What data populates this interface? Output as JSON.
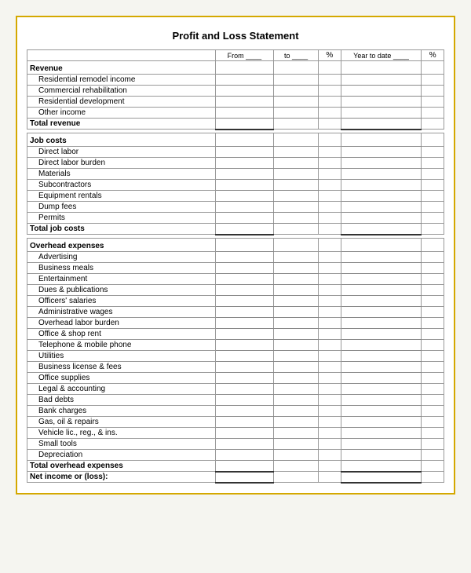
{
  "title": "Profit and Loss Statement",
  "header": {
    "col1": "",
    "col_from": "From ____",
    "col_to": "to ____",
    "col_pct1": "%",
    "col_ytd": "Year to date ____",
    "col_pct2": "%"
  },
  "sections": [
    {
      "type": "section-header",
      "label": "Revenue"
    },
    {
      "type": "indent",
      "label": "Residential remodel income"
    },
    {
      "type": "indent",
      "label": "Commercial rehabilitation"
    },
    {
      "type": "indent",
      "label": "Residential development"
    },
    {
      "type": "indent",
      "label": "Other income"
    },
    {
      "type": "total",
      "label": "Total revenue"
    },
    {
      "type": "blank"
    },
    {
      "type": "section-header",
      "label": "Job costs"
    },
    {
      "type": "indent",
      "label": "Direct labor"
    },
    {
      "type": "indent",
      "label": "Direct labor burden"
    },
    {
      "type": "indent",
      "label": "Materials"
    },
    {
      "type": "indent",
      "label": "Subcontractors"
    },
    {
      "type": "indent",
      "label": "Equipment rentals"
    },
    {
      "type": "indent",
      "label": "Dump fees"
    },
    {
      "type": "indent",
      "label": "Permits"
    },
    {
      "type": "total",
      "label": "Total job costs"
    },
    {
      "type": "blank"
    },
    {
      "type": "section-header",
      "label": "Overhead expenses"
    },
    {
      "type": "indent",
      "label": "Advertising"
    },
    {
      "type": "indent",
      "label": "Business meals"
    },
    {
      "type": "indent",
      "label": "Entertainment"
    },
    {
      "type": "indent",
      "label": "Dues & publications"
    },
    {
      "type": "indent",
      "label": "Officers' salaries"
    },
    {
      "type": "indent",
      "label": "Administrative wages"
    },
    {
      "type": "indent",
      "label": "Overhead labor burden"
    },
    {
      "type": "indent",
      "label": "Office & shop rent"
    },
    {
      "type": "indent",
      "label": "Telephone & mobile phone"
    },
    {
      "type": "indent",
      "label": "Utilities"
    },
    {
      "type": "indent",
      "label": "Business license & fees"
    },
    {
      "type": "indent",
      "label": "Office supplies"
    },
    {
      "type": "indent",
      "label": "Legal & accounting"
    },
    {
      "type": "indent",
      "label": "Bad debts"
    },
    {
      "type": "indent",
      "label": "Bank charges"
    },
    {
      "type": "indent",
      "label": "Gas, oil & repairs"
    },
    {
      "type": "indent",
      "label": "Vehicle lic., reg., & ins."
    },
    {
      "type": "indent",
      "label": "Small tools"
    },
    {
      "type": "indent",
      "label": "Depreciation"
    },
    {
      "type": "total",
      "label": "Total overhead expenses"
    },
    {
      "type": "net",
      "label": "Net income or (loss):"
    }
  ]
}
